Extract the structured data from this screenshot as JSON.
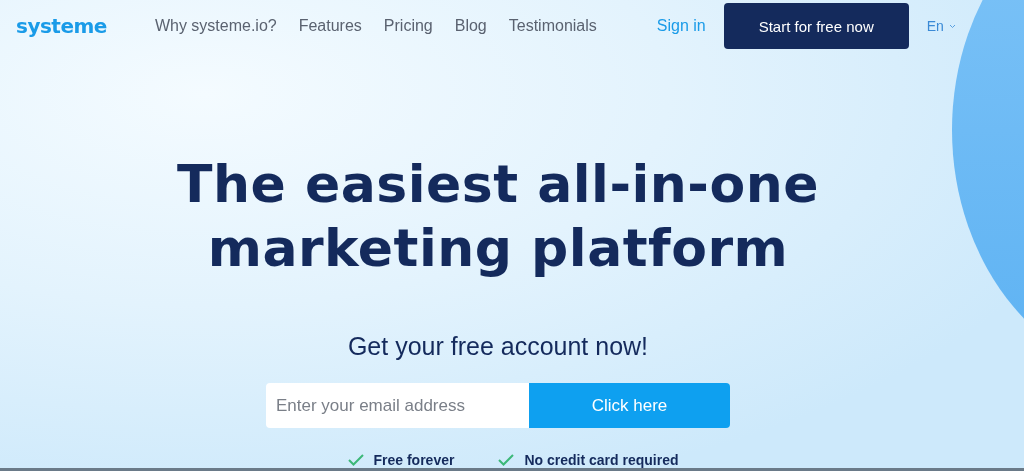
{
  "logo": "systeme",
  "nav": [
    {
      "label": "Why systeme.io?"
    },
    {
      "label": "Features"
    },
    {
      "label": "Pricing"
    },
    {
      "label": "Blog"
    },
    {
      "label": "Testimonials"
    }
  ],
  "sign_in": "Sign in",
  "cta": "Start for free now",
  "language": "En",
  "headline": [
    "The easiest all-in-one",
    "marketing platform"
  ],
  "subtitle": "Get your free account now!",
  "email": {
    "placeholder": "Enter your email address"
  },
  "submit": "Click here",
  "features": [
    "Free forever",
    "No credit card required"
  ]
}
